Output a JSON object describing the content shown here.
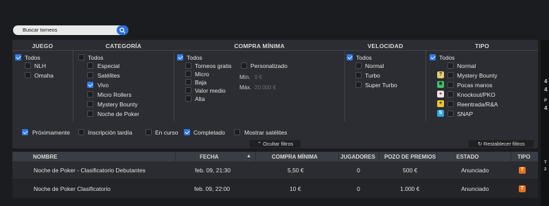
{
  "search": {
    "placeholder": "Buscar torneos"
  },
  "columns": {
    "juego": "JUEGO",
    "categoria": "CATEGORÍA",
    "compra": "COMPRA MÍNIMA",
    "velocidad": "VELOCIDAD",
    "tipo": "TIPO"
  },
  "juego": {
    "todos": "Todos",
    "items": [
      "NLH",
      "Omaha"
    ]
  },
  "categoria": {
    "todos": "Todos",
    "items": [
      "Especial",
      "Satélites",
      "Vivo",
      "Micro Rollers",
      "Mystery Bounty",
      "Noche de Poker"
    ],
    "checked": [
      false,
      false,
      true,
      false,
      false,
      false
    ]
  },
  "compra": {
    "todos": "Todos",
    "items": [
      "Torneos gratis",
      "Micro",
      "Baja",
      "Valor medio",
      "Alta"
    ],
    "personalizado": "Personalizado",
    "min_label": "Mín.",
    "min_value": "0 €",
    "max_label": "Máx.",
    "max_value": "20.000 €"
  },
  "velocidad": {
    "todos": "Todos",
    "items": [
      "Normal",
      "Turbo",
      "Super Turbo"
    ]
  },
  "tipo": {
    "todos": "Todos",
    "items": [
      "Normal",
      "Mystery Bounty",
      "Pocas manos",
      "Knockout/PKO",
      "Reentrada/R&A",
      "SNAP"
    ],
    "icon_names": [
      "none",
      "mystery-bounty-icon",
      "few-hands-icon",
      "knockout-icon",
      "reentry-icon",
      "snap-icon"
    ]
  },
  "bottom_filters": [
    "Próximamente",
    "Inscripción tardía",
    "En curso",
    "Completado",
    "Mostrar satélites"
  ],
  "bottom_checked": [
    true,
    false,
    false,
    true,
    false
  ],
  "hide_filters": "Ocultar filtros",
  "reset_filters": "Restablecer filtros",
  "table": {
    "headers": [
      "NOMBRE",
      "FECHA",
      "COMPRA MÍNIMA",
      "JUGADORES",
      "POZO DE PREMIOS",
      "ESTADO",
      "TIPO"
    ],
    "rows": [
      {
        "nombre": "Noche de Poker - Clasificatorio Debutantes",
        "fecha": "feb. 09, 21:30",
        "compra": "5,50 €",
        "jugadores": "0",
        "pozo": "500 €",
        "estado": "Anunciado",
        "tipo": "T"
      },
      {
        "nombre": "Noche de Poker Clasificatorio",
        "fecha": "feb. 09, 22:00",
        "compra": "10 €",
        "jugadores": "0",
        "pozo": "1.000 €",
        "estado": "Anunciado",
        "tipo": "T"
      }
    ]
  },
  "right_strip": [
    "4",
    "4",
    "P",
    "4",
    "T",
    "2"
  ],
  "colors": {
    "accent": "#2f7be8",
    "badge": "#e7721e"
  }
}
